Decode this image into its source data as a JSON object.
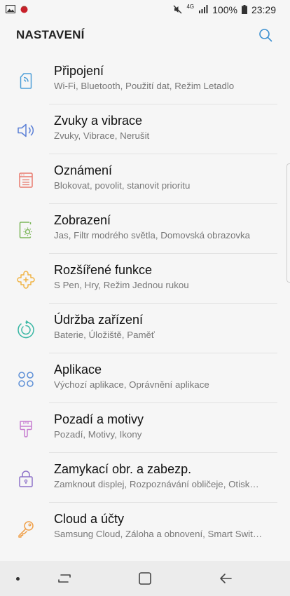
{
  "status": {
    "battery": "100%",
    "time": "23:29",
    "network": "4G"
  },
  "header": {
    "title": "NASTAVENÍ"
  },
  "colors": {
    "connections": "#4e9fd8",
    "sounds": "#5a7fd6",
    "notifications": "#e87a6e",
    "display": "#7cb65a",
    "advanced": "#f0b445",
    "maintenance": "#39b7a4",
    "apps": "#5d8fd6",
    "wallpapers": "#c77ed0",
    "lock": "#8e72c9",
    "cloud": "#f0a04a"
  },
  "items": [
    {
      "icon": "connections-icon",
      "label": "Připojení",
      "sub": "Wi-Fi, Bluetooth, Použití dat, Režim Letadlo"
    },
    {
      "icon": "speaker-icon",
      "label": "Zvuky a vibrace",
      "sub": "Zvuky, Vibrace, Nerušit"
    },
    {
      "icon": "notifications-icon",
      "label": "Oznámení",
      "sub": "Blokovat, povolit, stanovit prioritu"
    },
    {
      "icon": "display-icon",
      "label": "Zobrazení",
      "sub": "Jas, Filtr modrého světla, Domovská obrazovka"
    },
    {
      "icon": "puzzle-plus-icon",
      "label": "Rozšířené funkce",
      "sub": "S Pen, Hry, Režim Jednou rukou"
    },
    {
      "icon": "maintenance-icon",
      "label": "Údržba zařízení",
      "sub": "Baterie, Úložiště, Paměť"
    },
    {
      "icon": "apps-icon",
      "label": "Aplikace",
      "sub": "Výchozí aplikace, Oprávnění aplikace"
    },
    {
      "icon": "paint-brush-icon",
      "label": "Pozadí a motivy",
      "sub": "Pozadí, Motivy, Ikony"
    },
    {
      "icon": "lock-icon",
      "label": "Zamykací obr. a zabezp.",
      "sub": "Zamknout displej, Rozpoznávání obličeje, Otisk…"
    },
    {
      "icon": "key-icon",
      "label": "Cloud a účty",
      "sub": "Samsung Cloud, Záloha a obnovení, Smart Swit…"
    }
  ]
}
